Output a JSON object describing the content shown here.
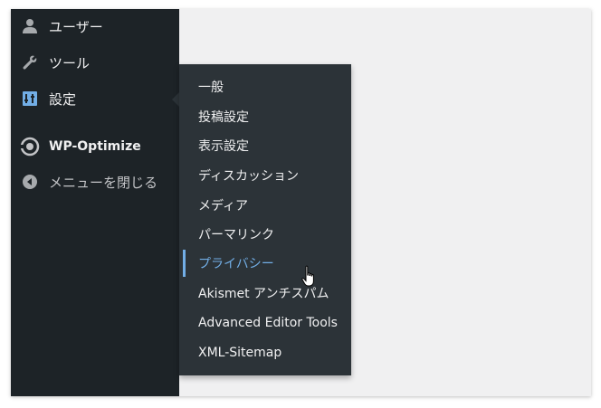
{
  "sidebar": {
    "items": [
      {
        "label": "ユーザー",
        "icon": "user-icon"
      },
      {
        "label": "ツール",
        "icon": "wrench-icon"
      },
      {
        "label": "設定",
        "icon": "settings-icon",
        "active": true
      },
      {
        "label": "WP-Optimize",
        "icon": "wp-optimize-icon"
      },
      {
        "label": "メニューを閉じる",
        "icon": "collapse-icon"
      }
    ]
  },
  "submenu": {
    "items": [
      {
        "label": "一般"
      },
      {
        "label": "投稿設定"
      },
      {
        "label": "表示設定"
      },
      {
        "label": "ディスカッション"
      },
      {
        "label": "メディア"
      },
      {
        "label": "パーマリンク"
      },
      {
        "label": "プライバシー",
        "current": true
      },
      {
        "label": "Akismet アンチスパム"
      },
      {
        "label": "Advanced Editor Tools"
      },
      {
        "label": "XML-Sitemap"
      }
    ]
  },
  "colors": {
    "sidebar_bg": "#1d2327",
    "submenu_bg": "#2c3338",
    "accent": "#72aee6",
    "content_bg": "#f0f0f1"
  }
}
